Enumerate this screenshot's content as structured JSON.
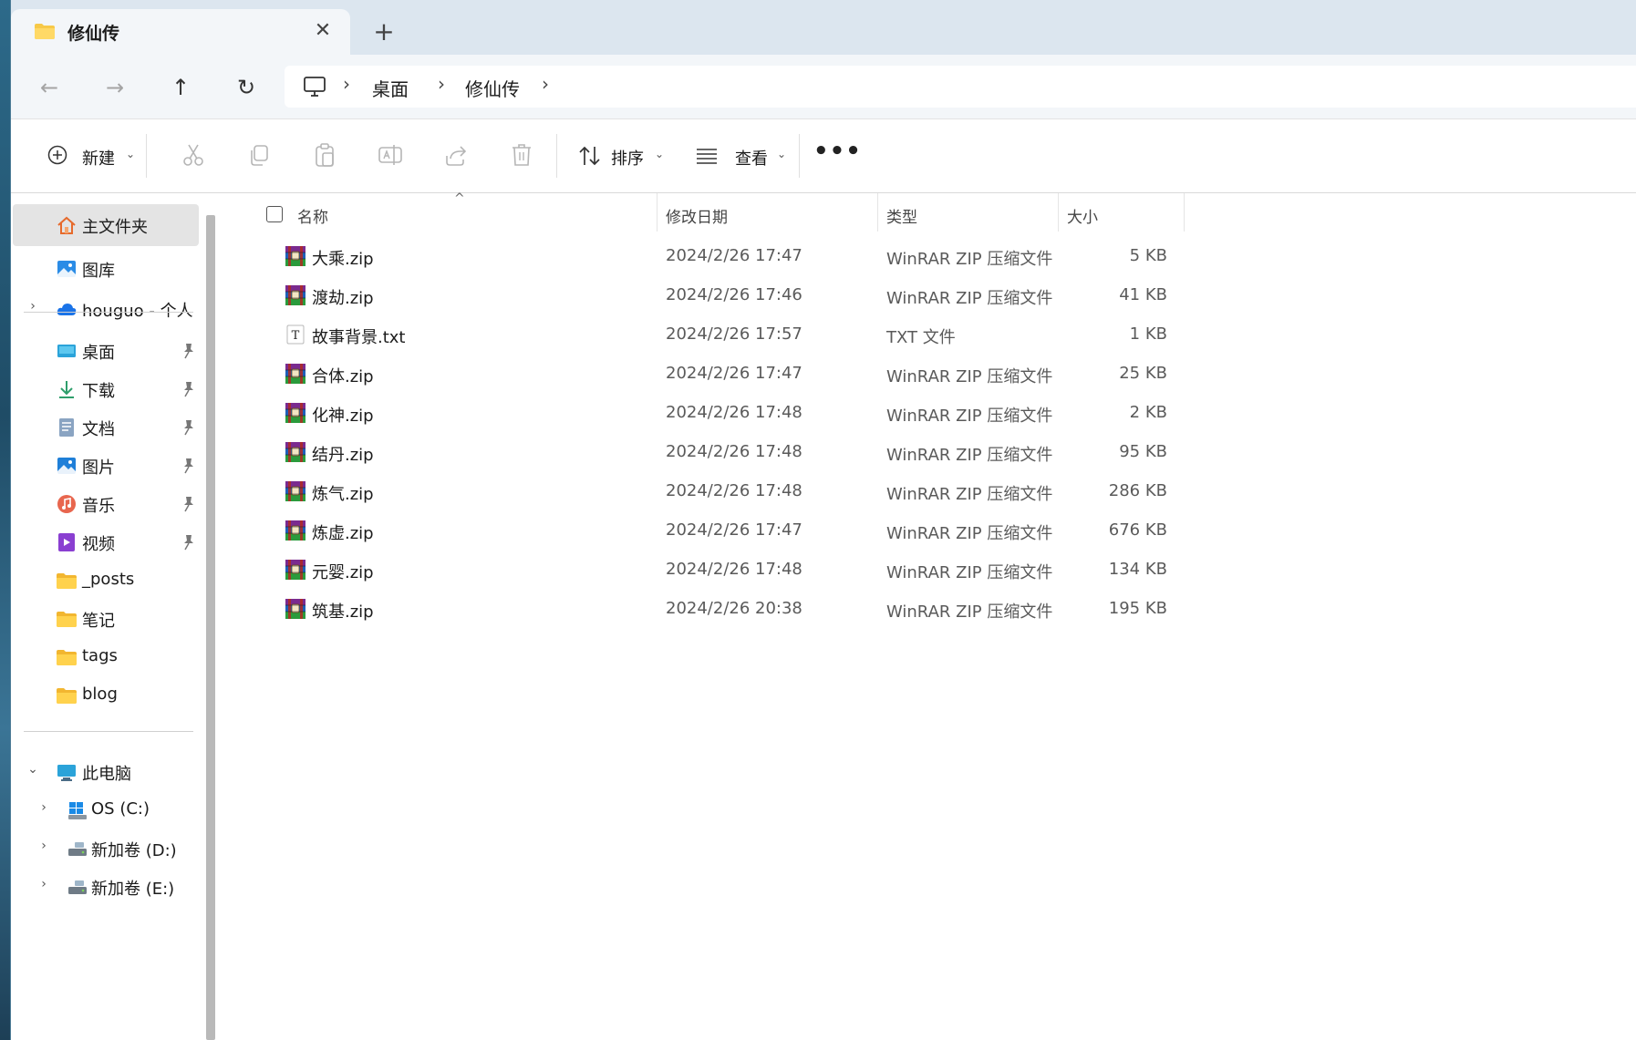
{
  "tab": {
    "title": "修仙传",
    "close_glyph": "✕",
    "new_tab_glyph": "+"
  },
  "nav": {
    "back_glyph": "←",
    "forward_glyph": "→",
    "up_glyph": "↑",
    "refresh_glyph": "↻",
    "separator": "›",
    "breadcrumbs": [
      "桌面",
      "修仙传"
    ]
  },
  "toolbar": {
    "new_label": "新建",
    "sort_label": "排序",
    "view_label": "查看",
    "more_glyph": "•••",
    "dropdown_glyph": "⌄"
  },
  "sidebar": {
    "chev_collapsed": "›",
    "chev_expanded": "⌄",
    "top": [
      {
        "label": "主文件夹",
        "icon": "home-icon"
      },
      {
        "label": "图库",
        "icon": "gallery-icon"
      },
      {
        "label": "houguo - 个人",
        "icon": "onedrive-cloud-icon"
      }
    ],
    "pinned": [
      {
        "label": "桌面",
        "icon": "desktop-icon"
      },
      {
        "label": "下载",
        "icon": "download-icon"
      },
      {
        "label": "文档",
        "icon": "documents-icon"
      },
      {
        "label": "图片",
        "icon": "pictures-icon"
      },
      {
        "label": "音乐",
        "icon": "music-icon"
      },
      {
        "label": "视频",
        "icon": "videos-icon"
      }
    ],
    "folders": [
      {
        "label": "_posts",
        "icon": "folder-icon"
      },
      {
        "label": "笔记",
        "icon": "folder-icon"
      },
      {
        "label": "tags",
        "icon": "folder-icon"
      },
      {
        "label": "blog",
        "icon": "folder-icon"
      }
    ],
    "computer": {
      "label": "此电脑",
      "icon": "this-pc-icon"
    },
    "drives": [
      {
        "label": "OS (C:)",
        "icon": "windows-drive-icon"
      },
      {
        "label": "新加卷 (D:)",
        "icon": "drive-icon"
      },
      {
        "label": "新加卷 (E:)",
        "icon": "drive-icon"
      }
    ]
  },
  "columns": {
    "name": "名称",
    "date": "修改日期",
    "type": "类型",
    "size": "大小",
    "sort_caret": "^"
  },
  "files": [
    {
      "name": "大乘.zip",
      "date": "2024/2/26 17:47",
      "type": "WinRAR ZIP 压缩文件",
      "size": "5 KB",
      "icon": "winrar-archive-icon"
    },
    {
      "name": "渡劫.zip",
      "date": "2024/2/26 17:46",
      "type": "WinRAR ZIP 压缩文件",
      "size": "41 KB",
      "icon": "winrar-archive-icon"
    },
    {
      "name": "故事背景.txt",
      "date": "2024/2/26 17:57",
      "type": "TXT 文件",
      "size": "1 KB",
      "icon": "text-file-icon",
      "icon_glyph": "T"
    },
    {
      "name": "合体.zip",
      "date": "2024/2/26 17:47",
      "type": "WinRAR ZIP 压缩文件",
      "size": "25 KB",
      "icon": "winrar-archive-icon"
    },
    {
      "name": "化神.zip",
      "date": "2024/2/26 17:48",
      "type": "WinRAR ZIP 压缩文件",
      "size": "2 KB",
      "icon": "winrar-archive-icon"
    },
    {
      "name": "结丹.zip",
      "date": "2024/2/26 17:48",
      "type": "WinRAR ZIP 压缩文件",
      "size": "95 KB",
      "icon": "winrar-archive-icon"
    },
    {
      "name": "炼气.zip",
      "date": "2024/2/26 17:48",
      "type": "WinRAR ZIP 压缩文件",
      "size": "286 KB",
      "icon": "winrar-archive-icon"
    },
    {
      "name": "炼虚.zip",
      "date": "2024/2/26 17:47",
      "type": "WinRAR ZIP 压缩文件",
      "size": "676 KB",
      "icon": "winrar-archive-icon"
    },
    {
      "name": "元婴.zip",
      "date": "2024/2/26 17:48",
      "type": "WinRAR ZIP 压缩文件",
      "size": "134 KB",
      "icon": "winrar-archive-icon"
    },
    {
      "name": "筑基.zip",
      "date": "2024/2/26 20:38",
      "type": "WinRAR ZIP 压缩文件",
      "size": "195 KB",
      "icon": "winrar-archive-icon"
    }
  ],
  "colors": {
    "accent": "#0067c0",
    "folder": "#f7c948",
    "selected_bg": "#e4e4e4",
    "titlebar_bg": "#dce6ef"
  }
}
